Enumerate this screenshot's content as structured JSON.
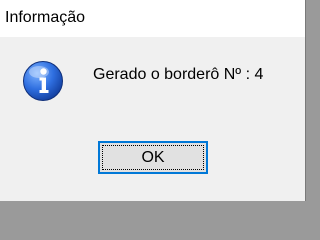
{
  "window": {
    "title": "Informação"
  },
  "message": {
    "text": "Gerado o borderô Nº : 4",
    "icon": "information-icon"
  },
  "buttons": {
    "ok_label": "OK"
  },
  "colors": {
    "titlebar": "#ffffff",
    "dialog_background": "#f0f0f0",
    "button_border_focus": "#0078d7",
    "icon_blue": "#1a5fcf"
  }
}
